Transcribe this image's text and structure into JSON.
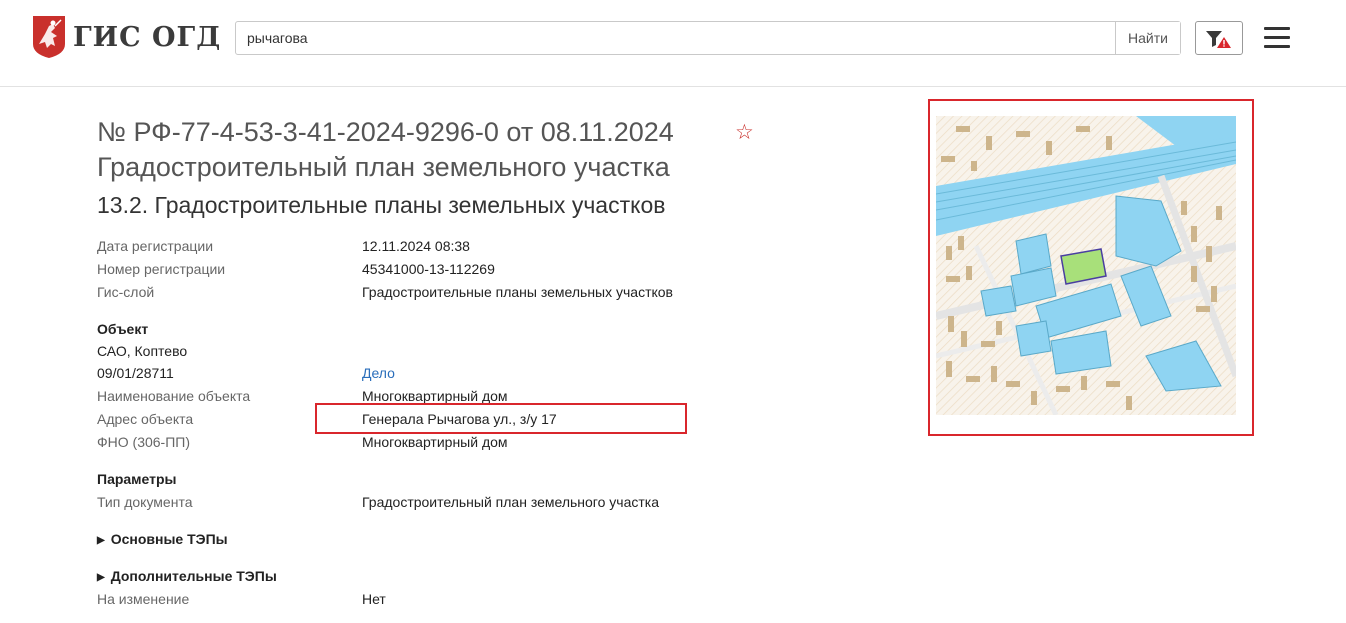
{
  "header": {
    "logo_text": "ГИС ОГД",
    "search": {
      "value": "рычагова",
      "button_label": "Найти"
    }
  },
  "colors": {
    "accent_red": "#d9262c",
    "link_blue": "#2a6ebb",
    "map_water": "#8fd4f2"
  },
  "document": {
    "number": "№ РФ-77-4-53-3-41-2024-9296-0 от 08.11.2024",
    "type": "Градостроительный план земельного участка",
    "layer_title": "13.2. Градостроительные планы земельных участков",
    "star_glyph": "☆"
  },
  "registration": [
    {
      "label": "Дата регистрации",
      "value": "12.11.2024 08:38"
    },
    {
      "label": "Номер регистрации",
      "value": "45341000-13-112269"
    },
    {
      "label": "Гис-слой",
      "value": "Градостроительные планы земельных участков"
    }
  ],
  "object": {
    "heading": "Объект",
    "district": "САО, Коптево",
    "case_id": "09/01/28711",
    "case_link": "Дело",
    "rows": [
      {
        "label": "Наименование объекта",
        "value": "Многоквартирный дом"
      },
      {
        "label": "Адрес объекта",
        "value": "Генерала Рычагова ул., з/у 17"
      },
      {
        "label": "ФНО (306-ПП)",
        "value": "Многоквартирный дом"
      }
    ]
  },
  "parameters": {
    "heading": "Параметры",
    "doc_type_label": "Тип документа",
    "doc_type_value": "Градостроительный план земельного участка"
  },
  "tep": {
    "main_label": "Основные ТЭПы",
    "extra_label": "Дополнительные ТЭПы",
    "toggle_glyph": "▶"
  },
  "change": {
    "label": "На изменение",
    "value": "Нет"
  }
}
